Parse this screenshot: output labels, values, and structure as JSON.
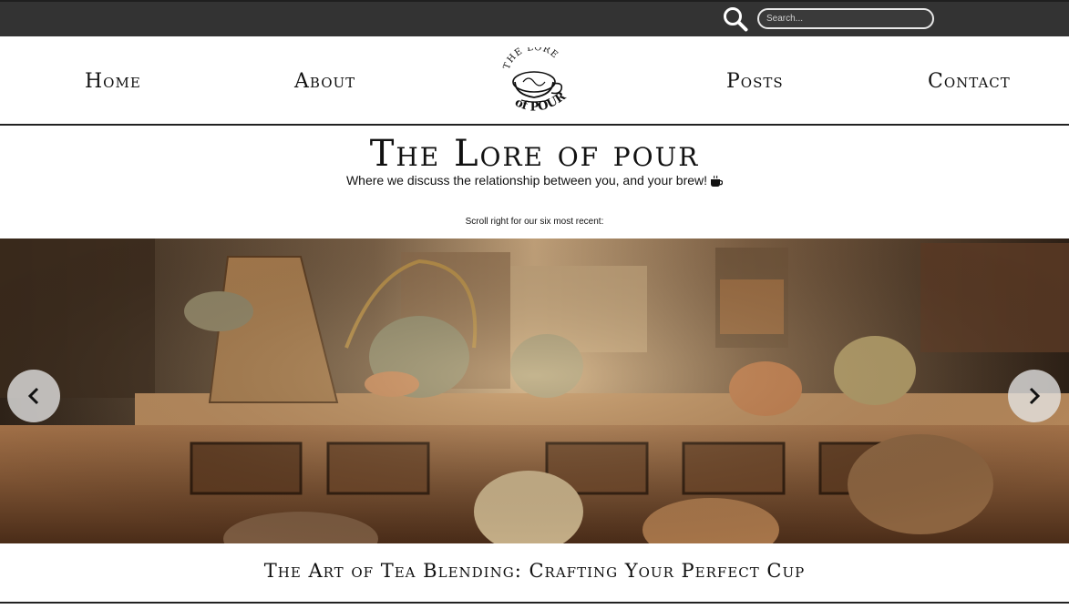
{
  "search": {
    "placeholder": "Search...",
    "icon": "search-icon"
  },
  "nav": {
    "items": [
      {
        "label": "Home"
      },
      {
        "label": "About"
      },
      {
        "label": "Posts"
      },
      {
        "label": "Contact"
      }
    ],
    "logo": {
      "top_text": "THE LORE",
      "bottom_text": "of POUR"
    }
  },
  "header": {
    "title": "The Lore of pour",
    "tagline": "Where we discuss the relationship between you, and your brew!",
    "tagline_icon": "coffee-cup-icon"
  },
  "carousel": {
    "note": "Scroll right for our six most recent:",
    "prev_icon": "chevron-left-icon",
    "next_icon": "chevron-right-icon",
    "current_post_title": "The Art of Tea Blending: Crafting Your Perfect Cup"
  },
  "colors": {
    "topbar": "#333333",
    "text": "#111111",
    "background": "#ffffff",
    "arrow_bg": "#e6e6e6"
  }
}
